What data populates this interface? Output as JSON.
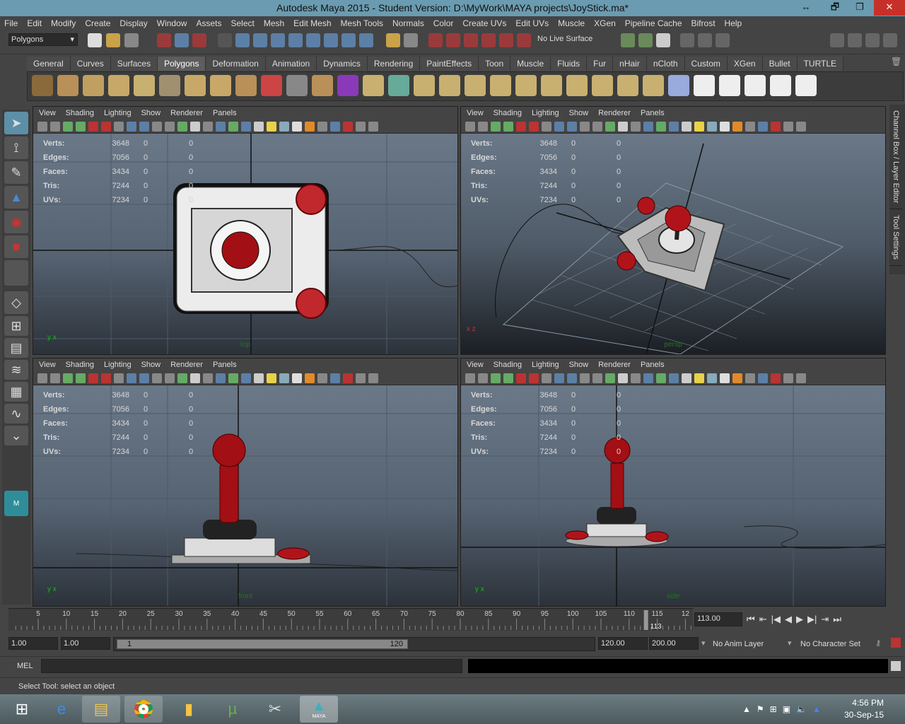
{
  "window": {
    "title": "Autodesk Maya 2015 - Student Version: D:\\MyWork\\MAYA projects\\JoyStick.ma*",
    "restore_glyph": "↔",
    "max_glyph": "❐",
    "min_glyph": "🗗",
    "close_glyph": "✕"
  },
  "menu": [
    "File",
    "Edit",
    "Modify",
    "Create",
    "Display",
    "Window",
    "Assets",
    "Select",
    "Mesh",
    "Edit Mesh",
    "Mesh Tools",
    "Normals",
    "Color",
    "Create UVs",
    "Edit UVs",
    "Muscle",
    "XGen",
    "Pipeline Cache",
    "Bifrost",
    "Help"
  ],
  "status": {
    "mode": "Polygons",
    "live_surface": "No Live Surface"
  },
  "shelf_tabs": [
    "General",
    "Curves",
    "Surfaces",
    "Polygons",
    "Deformation",
    "Animation",
    "Dynamics",
    "Rendering",
    "PaintEffects",
    "Toon",
    "Muscle",
    "Fluids",
    "Fur",
    "nHair",
    "nCloth",
    "Custom",
    "XGen",
    "Bullet",
    "TURTLE"
  ],
  "shelf_active": "Polygons",
  "panel_menu": [
    "View",
    "Shading",
    "Lighting",
    "Show",
    "Renderer",
    "Panels"
  ],
  "hud": {
    "labels": [
      "Verts:",
      "Edges:",
      "Faces:",
      "Tris:",
      "UVs:"
    ],
    "values": [
      "3648",
      "7056",
      "3434",
      "7244",
      "7234"
    ],
    "zero": "0"
  },
  "cameras": {
    "top": "top",
    "persp": "persp",
    "front": "front",
    "side": "side"
  },
  "axes": {
    "xy": "y x",
    "xz": "x z"
  },
  "side_tabs": [
    "Channel Box / Layer Editor",
    "Tool Settings"
  ],
  "timeline": {
    "ticks": [
      "5",
      "10",
      "15",
      "20",
      "25",
      "30",
      "35",
      "40",
      "45",
      "50",
      "55",
      "60",
      "65",
      "70",
      "75",
      "80",
      "85",
      "90",
      "95",
      "100",
      "105",
      "110",
      "115",
      "12"
    ],
    "current": "113",
    "current_field": "113.00"
  },
  "range": {
    "start": "1.00",
    "start2": "1.00",
    "slider_start": "1",
    "slider_end": "120",
    "end": "120.00",
    "end2": "200.00",
    "anim_layer": "No Anim Layer",
    "char_set": "No Character Set"
  },
  "mel": {
    "label": "MEL"
  },
  "help": {
    "text": "Select Tool: select an object"
  },
  "taskbar": {
    "time": "4:56 PM",
    "date": "30-Sep-15",
    "maya_label": "MAYA"
  },
  "colors": {
    "accent": "#5d8fa8",
    "red": "#b0141a",
    "title": "#6a9bb0"
  }
}
